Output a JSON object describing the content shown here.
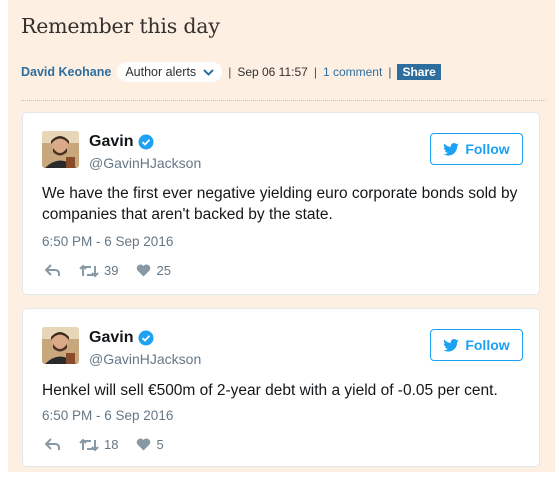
{
  "article": {
    "headline": "Remember this day",
    "author": "David Keohane",
    "author_alerts_label": "Author alerts",
    "date": "Sep 06 11:57",
    "comments": "1 comment",
    "share_label": "Share"
  },
  "colors": {
    "page_background": "#fdf0e3",
    "link_blue": "#2e6e9e",
    "twitter_blue": "#1da1f2"
  },
  "tweets": [
    {
      "name": "Gavin",
      "handle": "@GavinHJackson",
      "follow_label": "Follow",
      "text": "We have the first ever negative yielding euro corporate bonds sold by companies that aren't backed by the state.",
      "time": "6:50 PM - 6 Sep 2016",
      "retweets": "39",
      "likes": "25"
    },
    {
      "name": "Gavin",
      "handle": "@GavinHJackson",
      "follow_label": "Follow",
      "text": "Henkel will sell €500m of 2-year debt with a yield of -0.05 per cent.",
      "time": "6:50 PM - 6 Sep 2016",
      "retweets": "18",
      "likes": "5"
    }
  ],
  "icons": [
    "chevron-down-icon",
    "verified-badge-icon",
    "twitter-bird-icon",
    "reply-icon",
    "retweet-icon",
    "heart-icon"
  ]
}
